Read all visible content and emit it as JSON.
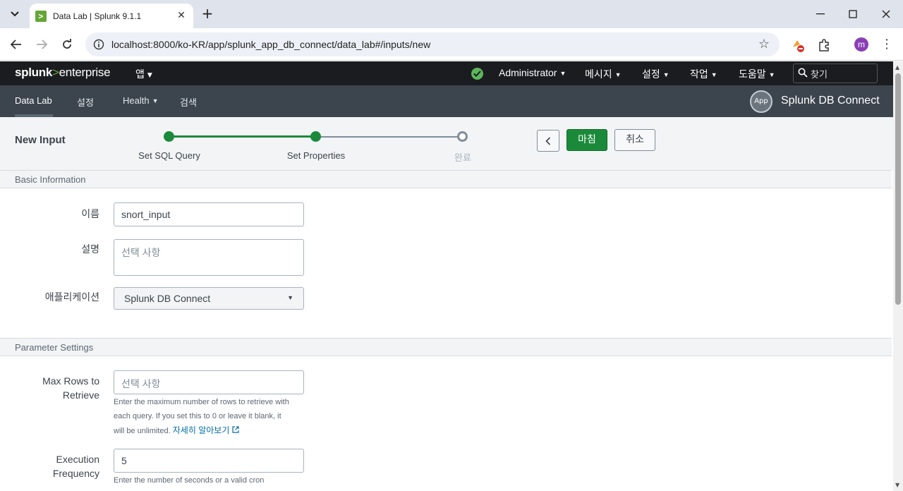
{
  "browser": {
    "tab_title": "Data Lab | Splunk 9.1.1",
    "url": "localhost:8000/ko-KR/app/splunk_app_db_connect/data_lab#/inputs/new",
    "profile_initial": "m"
  },
  "header": {
    "logo_brand": "splunk",
    "logo_gt": ">",
    "logo_product": "enterprise",
    "app_menu": "앱",
    "menus": [
      "Administrator",
      "메시지",
      "설정",
      "작업",
      "도움말"
    ],
    "search_placeholder": "찾기",
    "status_color": "#5cb65b"
  },
  "app_nav": {
    "items": [
      "Data Lab",
      "설정",
      "Health",
      "검색"
    ],
    "app_logo_text": "App",
    "app_name": "Splunk DB Connect"
  },
  "wizard": {
    "title": "New Input",
    "steps": [
      {
        "label": "Set SQL Query",
        "state": "done"
      },
      {
        "label": "Set Properties",
        "state": "done"
      },
      {
        "label": "완료",
        "state": "pending"
      }
    ],
    "finish_label": "마침",
    "cancel_label": "취소"
  },
  "basic": {
    "section_title": "Basic Information",
    "name_label": "이름",
    "name_value": "snort_input",
    "desc_label": "설명",
    "desc_placeholder": "선택 사항",
    "app_label": "애플리케이션",
    "app_value": "Splunk DB Connect"
  },
  "params": {
    "section_title": "Parameter Settings",
    "max_rows_label_1": "Max Rows to",
    "max_rows_label_2": "Retrieve",
    "max_rows_placeholder": "선택 사항",
    "max_rows_help_1": "Enter the maximum number of rows to retrieve with",
    "max_rows_help_2": "each query. If you set this to 0 or leave it blank, it",
    "max_rows_help_3": "will be unlimited.",
    "learn_more": "자세히 알아보기",
    "exec_label_1": "Execution",
    "exec_label_2": "Frequency",
    "exec_value": "5",
    "exec_help": "Enter the number of seconds or a valid cron"
  }
}
